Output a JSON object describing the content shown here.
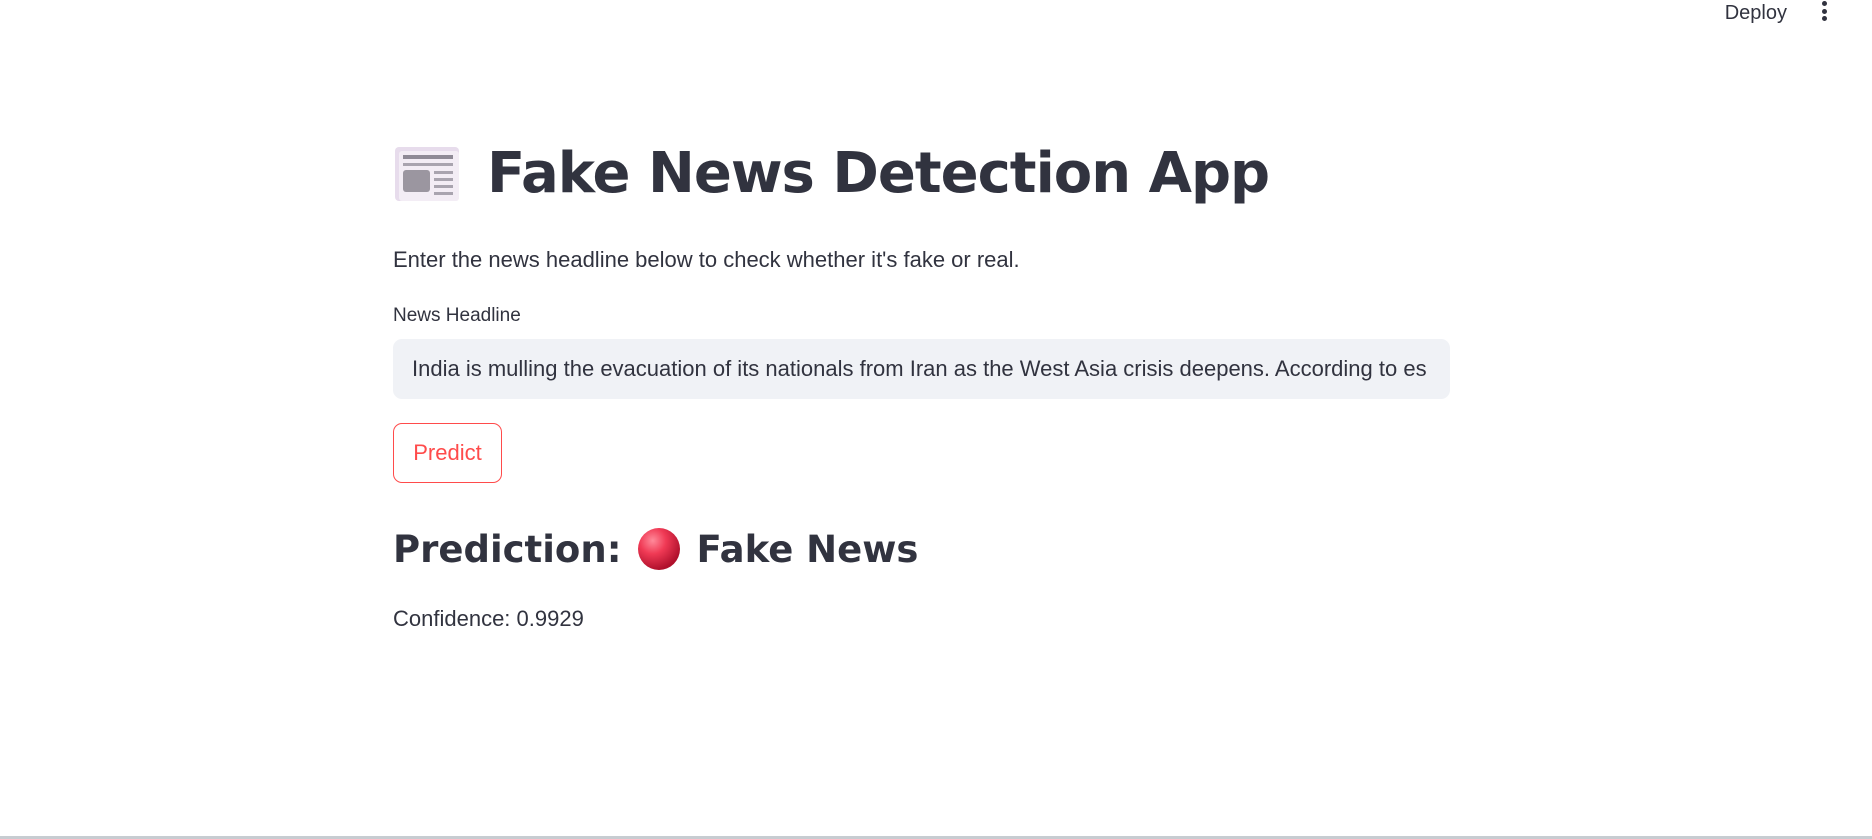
{
  "header": {
    "deploy_label": "Deploy",
    "menu_icon": "vertical-ellipsis-icon"
  },
  "main": {
    "title_icon": "newspaper-icon",
    "title": "Fake News Detection App",
    "subtitle": "Enter the news headline below to check whether it's fake or real.",
    "input_label": "News Headline",
    "input_value": "India is mulling the evacuation of its nationals from Iran as the West Asia crisis deepens. According to es",
    "predict_label": "Predict",
    "prediction_label": "Prediction:",
    "prediction_icon": "red-circle-icon",
    "prediction_value": "Fake News",
    "confidence_text": "Confidence: 0.9929"
  },
  "colors": {
    "accent": "#ff4b4b",
    "text": "#31333f",
    "input_bg": "#f0f2f6"
  }
}
